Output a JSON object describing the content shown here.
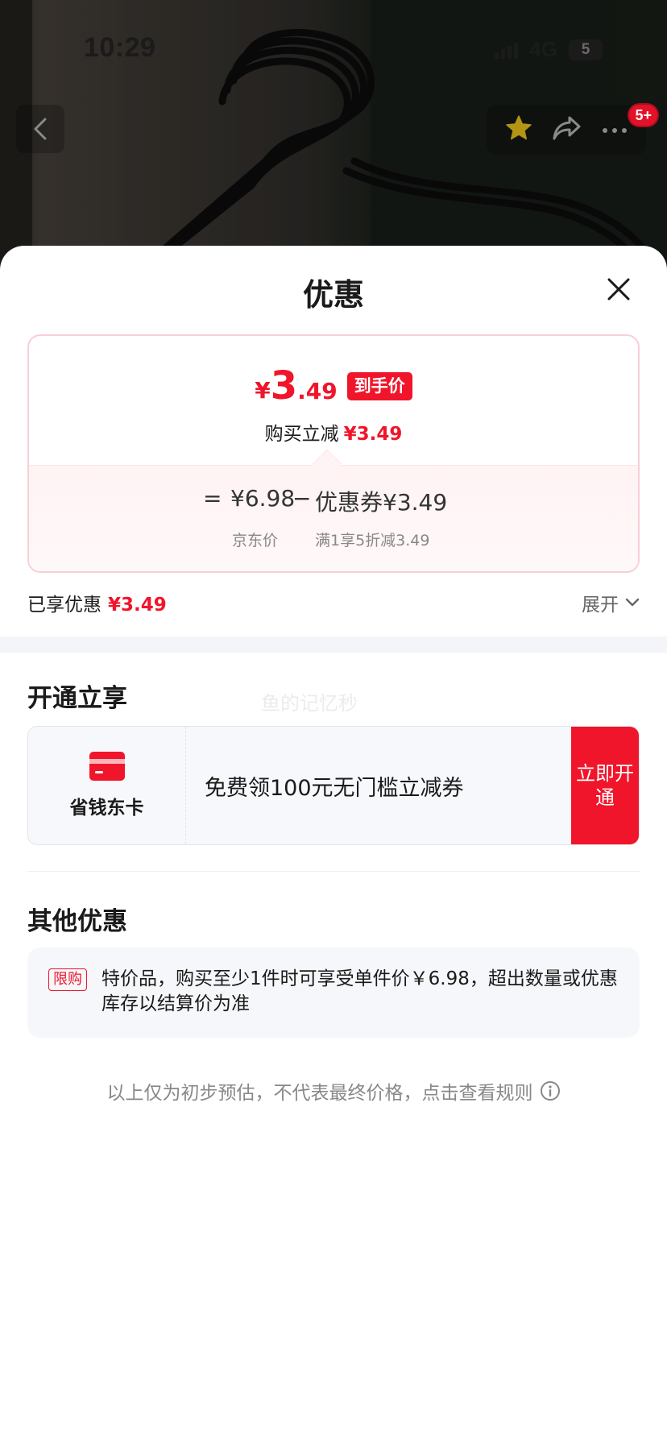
{
  "status_bar": {
    "time": "10:29",
    "network": "4G",
    "battery": "5"
  },
  "product_header": {
    "cart_badge": "5+",
    "icons": [
      "back-arrow-icon",
      "star-icon",
      "share-icon",
      "more-icon"
    ],
    "favorite_color": "#e5b90c"
  },
  "sheet": {
    "title": "优惠",
    "final_price": {
      "currency": "¥",
      "integer": "3",
      "decimal": ".49",
      "tag": "到手价"
    },
    "instant_reduce": {
      "label": "购买立减",
      "amount": "¥3.49"
    },
    "calc": {
      "equals": "=",
      "jd_price": "¥6.98",
      "minus": "−",
      "coupon": "优惠券¥3.49",
      "jd_price_label": "京东价",
      "coupon_desc": "满1享5折减3.49"
    },
    "applied": {
      "label": "已享优惠",
      "amount": "¥3.49",
      "expand_label": "展开"
    }
  },
  "open_section": {
    "title": "开通立享",
    "watermark": "鱼的记忆秒",
    "card": {
      "name": "省钱东卡",
      "description": "免费领100元无门槛立减券",
      "button": "立即开通"
    }
  },
  "other_section": {
    "title": "其他优惠",
    "tag": "限购",
    "text": "特价品，购买至少1件时可享受单件价￥6.98，超出数量或优惠库存以结算价为准"
  },
  "disclaimer": "以上仅为初步预估，不代表最终价格，点击查看规则",
  "colors": {
    "accent": "#f0152a",
    "card_border": "#f9cfd5",
    "muted": "#888888"
  }
}
